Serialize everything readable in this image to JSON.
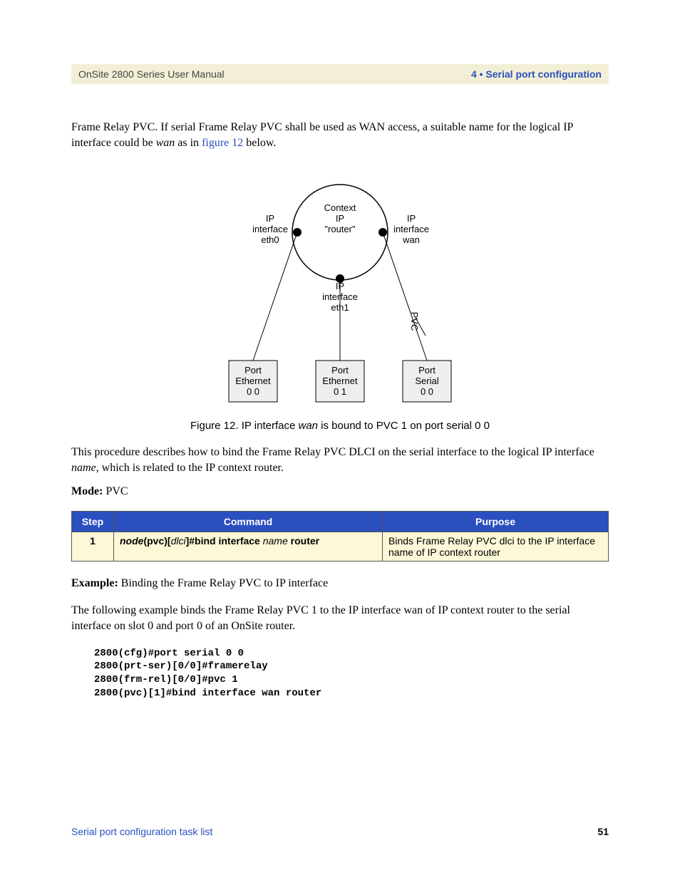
{
  "header": {
    "left": "OnSite 2800 Series User Manual",
    "right": "4 • Serial port configuration"
  },
  "intro": {
    "line1_a": "Frame Relay PVC. If serial Frame Relay PVC shall be used as WAN access, a suitable name for the logical IP ",
    "line2_a": "interface could be ",
    "line2_wan": "wan",
    "line2_b": " as in ",
    "line2_link": "figure 12",
    "line2_c": " below."
  },
  "diagram": {
    "context1": "Context",
    "context2": "IP",
    "context3": "\"router\"",
    "if_left1": "IP",
    "if_left2": "interface",
    "if_left3": "eth0",
    "if_mid1": "IP",
    "if_mid2": "interface",
    "if_mid3": "eth1",
    "if_right1": "IP",
    "if_right2": "interface",
    "if_right3": "wan",
    "port1a": "Port",
    "port1b": "Ethernet",
    "port1c": "0 0",
    "port2a": "Port",
    "port2b": "Ethernet",
    "port2c": "0 1",
    "port3a": "Port",
    "port3b": "Serial",
    "port3c": "0 0",
    "pvc": "PVC"
  },
  "caption": {
    "pre": "Figure 12. IP interface ",
    "ital": "wan",
    "post": " is bound to PVC 1 on port serial 0 0"
  },
  "para2_a": "This procedure describes how to bind the Frame Relay PVC DLCI on the serial interface to the logical IP ",
  "para2_b": "interface ",
  "para2_name": "name",
  "para2_c": ", which is related to the IP context router.",
  "mode_label": "Mode:",
  "mode_value": " PVC",
  "table": {
    "h_step": "Step",
    "h_cmd": "Command",
    "h_purpose": "Purpose",
    "row1": {
      "step": "1",
      "cmd_prefix": "node",
      "cmd_p1": "(pvc)[",
      "cmd_dlci": "dlci",
      "cmd_p2": "]#bind interface",
      "cmd_name": " name ",
      "cmd_router": "router",
      "purpose": "Binds Frame Relay PVC dlci to the IP interface name of IP context router"
    }
  },
  "example_label": "Example:",
  "example_text": " Binding the Frame Relay PVC to IP interface",
  "example_para": "The following example binds the Frame Relay PVC 1 to the IP interface wan of IP context router to the serial interface on slot 0 and port 0 of an OnSite router.",
  "code": "2800(cfg)#port serial 0 0\n2800(prt-ser)[0/0]#framerelay\n2800(frm-rel)[0/0]#pvc 1\n2800(pvc)[1]#bind interface wan router",
  "footer": {
    "left": "Serial port configuration task list",
    "right": "51"
  }
}
